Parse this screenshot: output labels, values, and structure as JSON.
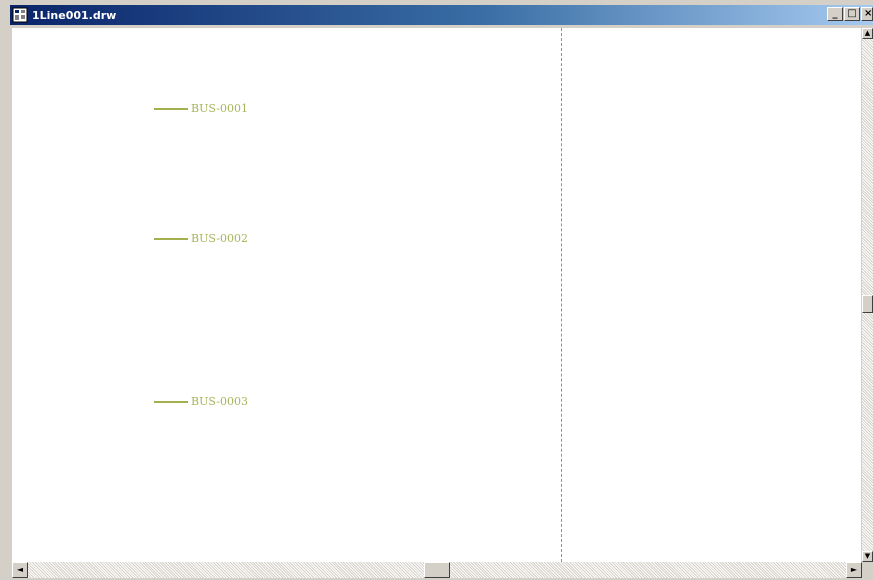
{
  "window": {
    "title": "1Line001.drw",
    "icon": "drawing-document-icon",
    "buttons": {
      "minimize": "_",
      "maximize": "□",
      "close": "×"
    }
  },
  "canvas": {
    "buses": [
      {
        "label": "BUS-0001"
      },
      {
        "label": "BUS-0002"
      },
      {
        "label": "BUS-0003"
      }
    ],
    "bus_color": "#a4b050",
    "label_color": "#a8b45a"
  },
  "scrollbars": {
    "vertical": {
      "up": "▲",
      "down": "▼"
    },
    "horizontal": {
      "left": "◄",
      "right": "►"
    }
  }
}
